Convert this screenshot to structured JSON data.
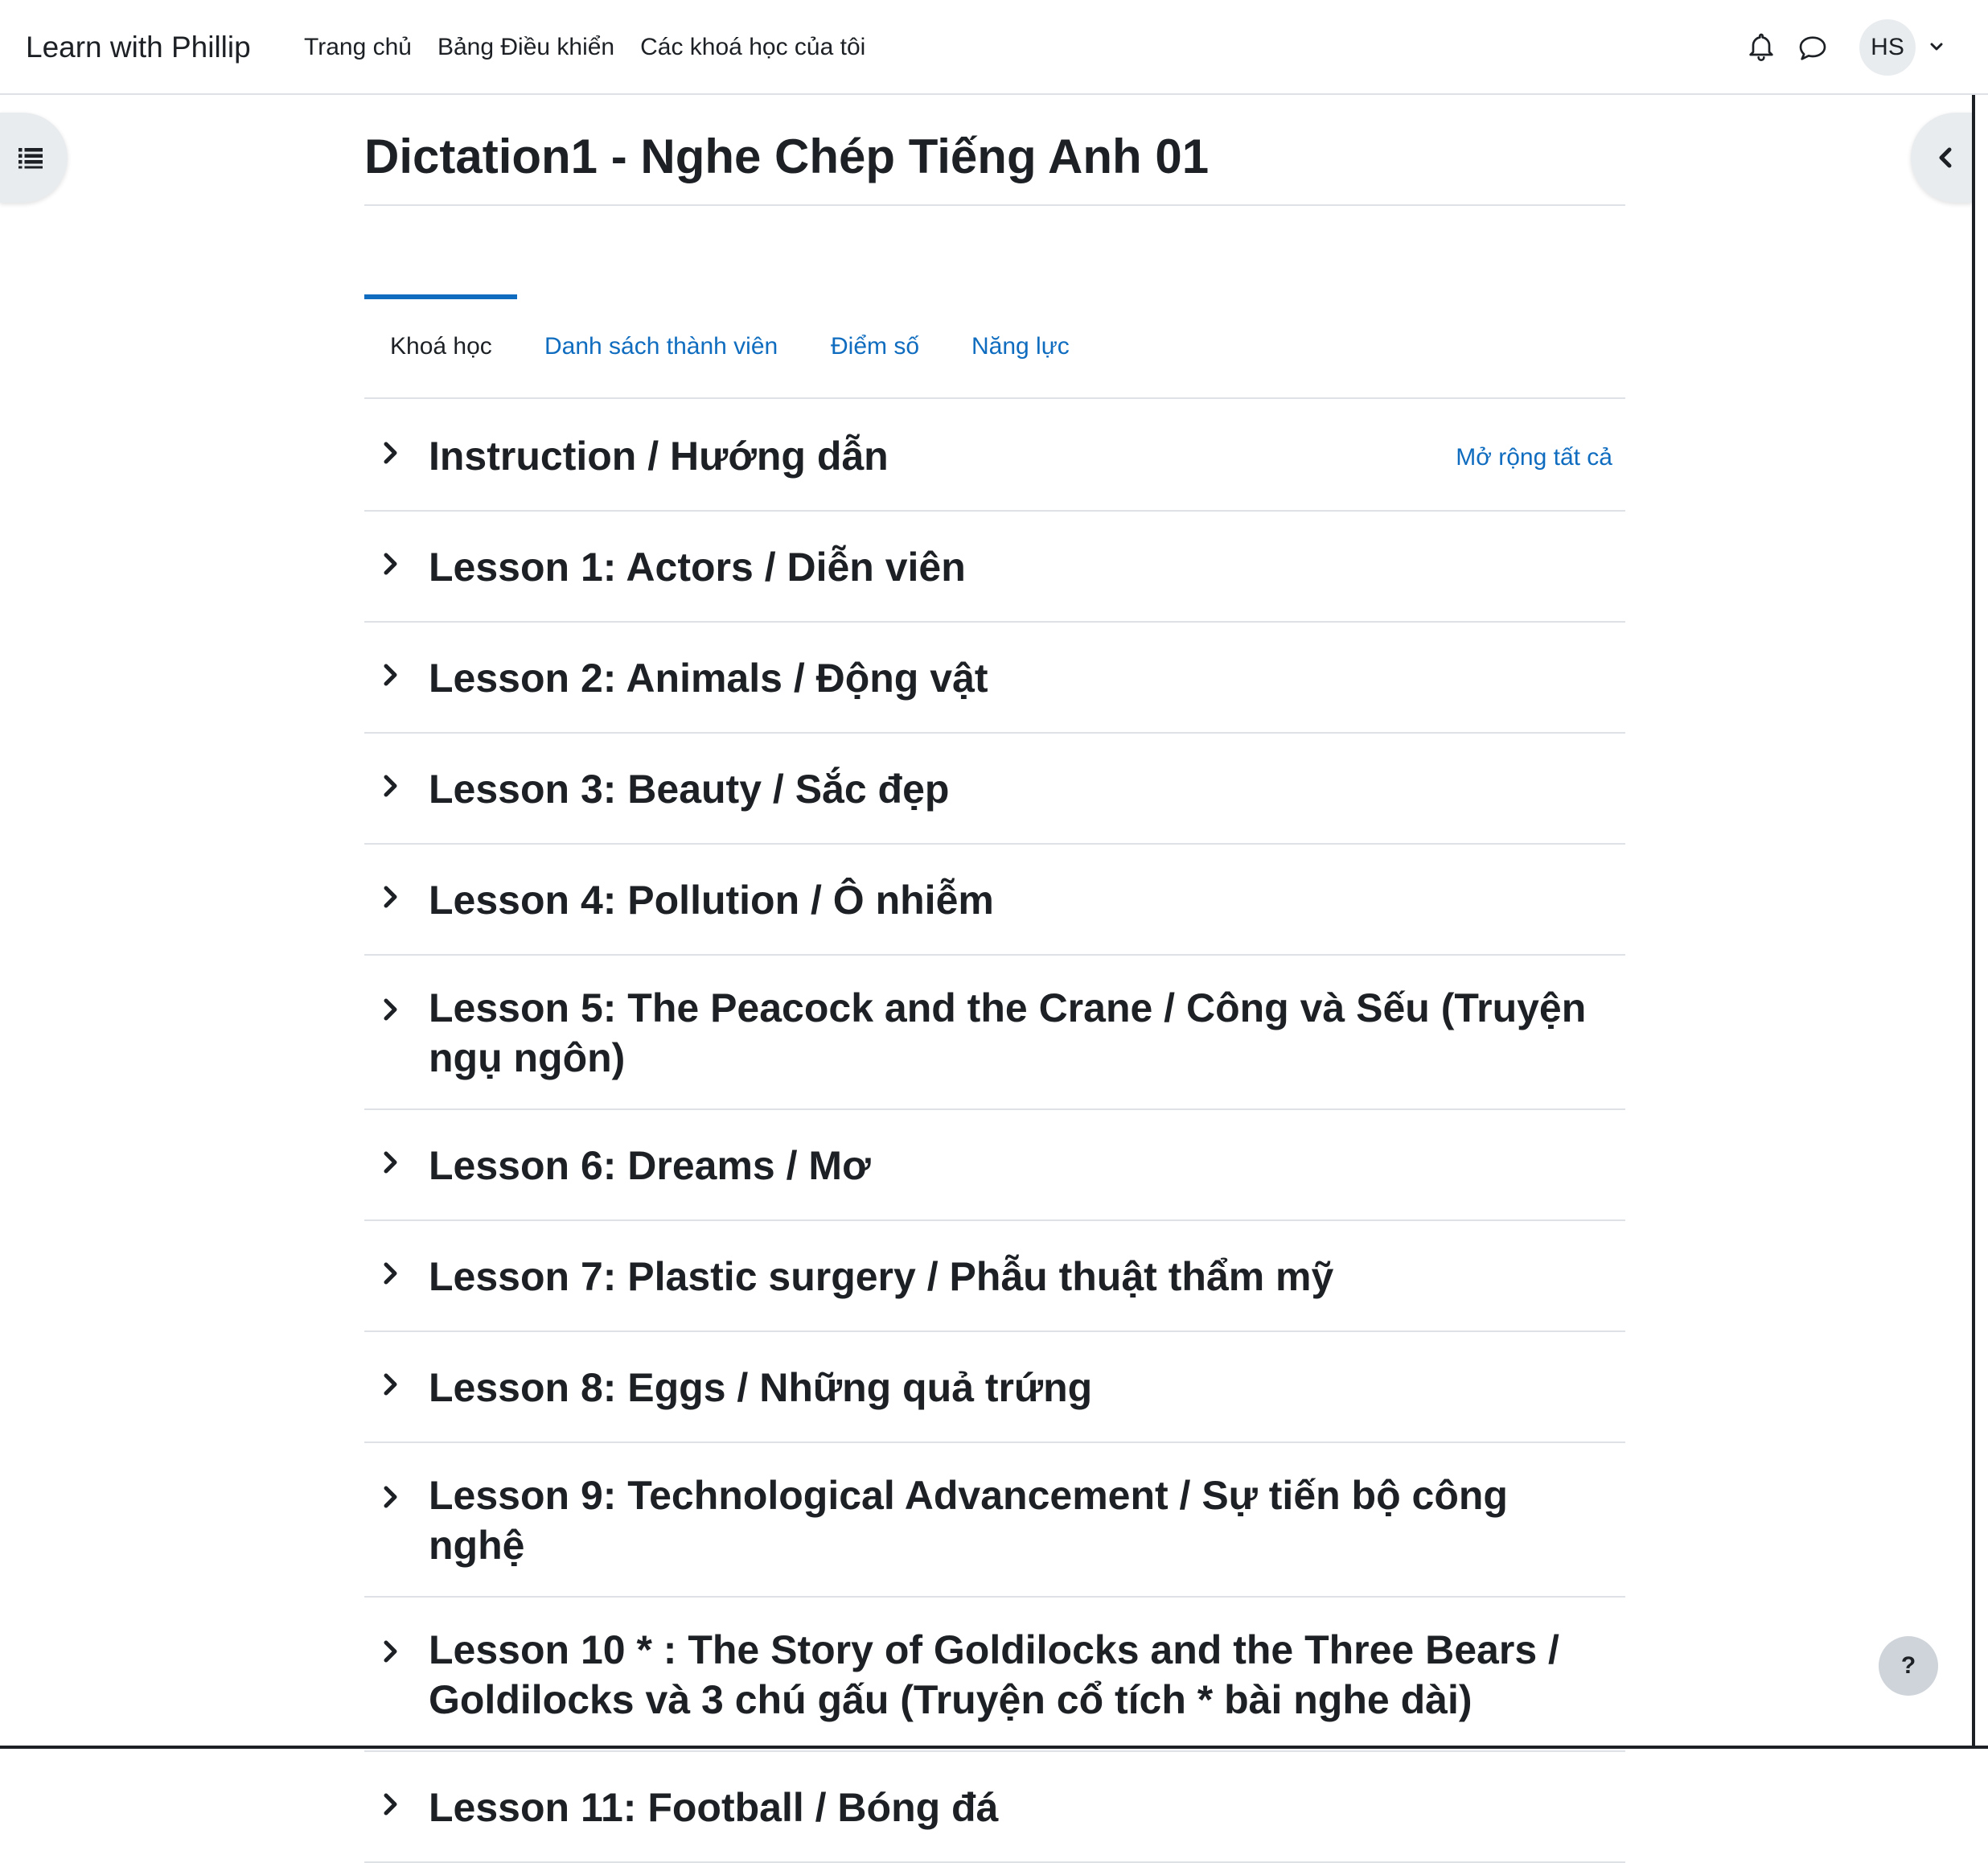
{
  "navbar": {
    "brand": "Learn with Phillip",
    "links": [
      "Trang chủ",
      "Bảng Điều khiển",
      "Các khoá học của tôi"
    ],
    "avatar_initials": "HS"
  },
  "course": {
    "title": "Dictation1 - Nghe Chép Tiếng Anh 01"
  },
  "tabs": [
    {
      "label": "Khoá học",
      "active": true
    },
    {
      "label": "Danh sách thành viên",
      "active": false
    },
    {
      "label": "Điểm số",
      "active": false
    },
    {
      "label": "Năng lực",
      "active": false
    }
  ],
  "expand_all": "Mở rộng tất cả",
  "sections": [
    {
      "title": "Instruction / Hướng dẫn"
    },
    {
      "title": "Lesson 1: Actors / Diễn viên"
    },
    {
      "title": "Lesson 2: Animals / Động vật"
    },
    {
      "title": "Lesson 3: Beauty / Sắc đẹp"
    },
    {
      "title": "Lesson 4: Pollution / Ô nhiễm"
    },
    {
      "title": "Lesson 5: The Peacock and the Crane / Công và Sếu (Truyện ngụ ngôn)"
    },
    {
      "title": "Lesson 6: Dreams / Mơ"
    },
    {
      "title": "Lesson 7: Plastic surgery / Phẫu thuật thẩm mỹ"
    },
    {
      "title": "Lesson 8: Eggs / Những quả trứng"
    },
    {
      "title": "Lesson 9: Technological Advancement / Sự tiến bộ công nghệ"
    },
    {
      "title": "Lesson 10 * : The Story of Goldilocks and the Three Bears / Goldilocks và 3 chú gấu (Truyện cổ tích * bài nghe dài)"
    },
    {
      "title": "Lesson 11: Football / Bóng đá"
    }
  ],
  "help_label": "?",
  "colors": {
    "link": "#0f6cbf",
    "text": "#1d2125",
    "border": "#dee2e6",
    "drawer_bg": "#e9ecef"
  },
  "icons": {
    "drawer_left": "list-icon",
    "drawer_right": "chevron-left-icon",
    "notifications": "bell-icon",
    "messages": "chat-bubble-icon",
    "user_menu": "chevron-down-icon",
    "section_toggle": "chevron-right-icon"
  }
}
